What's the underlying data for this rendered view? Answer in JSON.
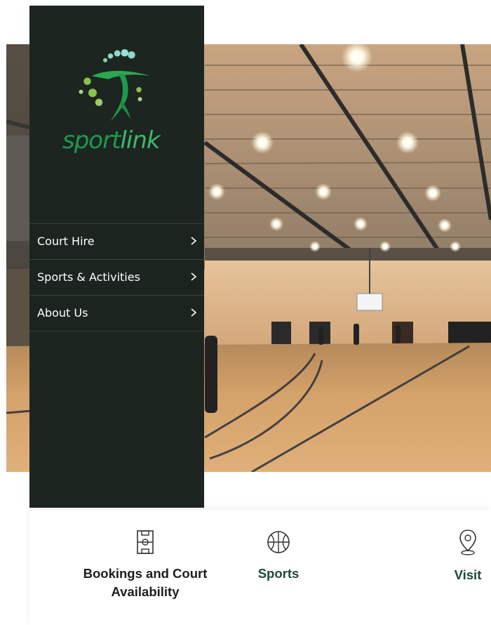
{
  "brand": {
    "name_part1": "sport",
    "name_part2": "link",
    "color_primary": "#1e9a4c",
    "color_accent": "#3fb76c"
  },
  "menu": {
    "items": [
      {
        "label": "Court Hire",
        "icon": "chevron-right-icon"
      },
      {
        "label": "Sports & Activities",
        "icon": "chevron-right-icon"
      },
      {
        "label": "About Us",
        "icon": "chevron-right-icon"
      }
    ]
  },
  "hero": {
    "image": "indoor-basketball-court-photo"
  },
  "features": {
    "items": [
      {
        "label": "Bookings and Court Availability",
        "icon": "court-icon"
      },
      {
        "label": "Sports",
        "icon": "basketball-icon"
      },
      {
        "label": "Visit",
        "icon": "location-pin-icon"
      }
    ]
  },
  "colors": {
    "sidebar_bg": "#1c2520",
    "feature_text": "#1d4a35"
  }
}
